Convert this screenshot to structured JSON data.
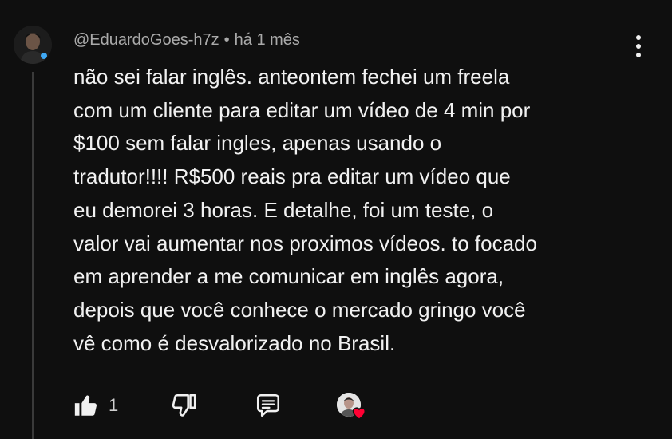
{
  "comment": {
    "author": "@EduardoGoes-h7z",
    "separator": "•",
    "time": "há 1 mês",
    "lines": [
      "não sei falar inglês. anteontem fechei um freela",
      "com um cliente para editar um vídeo de 4 min por",
      "$100 sem falar ingles, apenas usando o",
      "tradutor!!!! R$500 reais pra editar um vídeo que",
      "eu demorei 3 horas. E detalhe, foi um teste, o",
      "valor vai aumentar nos proximos vídeos. to focado",
      "em aprender a me comunicar em inglês agora,",
      "depois que você conhece o mercado gringo você",
      "vê como é desvalorizado no Brasil."
    ]
  },
  "actions": {
    "like_count": "1",
    "icons": [
      "thumbs-up-icon",
      "thumbs-down-icon",
      "reply-icon",
      "creator-heart-icon"
    ]
  },
  "colors": {
    "background": "#0f0f0f",
    "text": "#f1f1f1",
    "meta": "#aaaaaa",
    "heart": "#ff0033"
  }
}
